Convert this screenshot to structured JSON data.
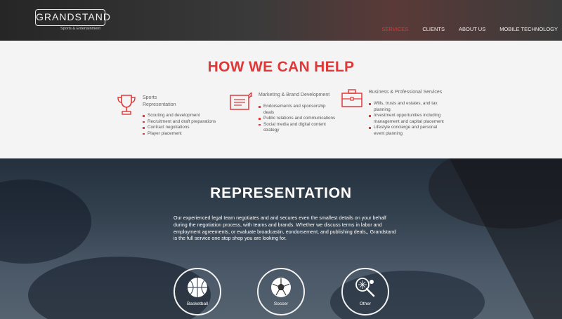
{
  "header": {
    "logo": "GRANDSTAND",
    "tagline": "Sports & Entertainment",
    "nav": [
      {
        "label": "SERVICES",
        "active": true
      },
      {
        "label": "CLIENTS",
        "active": false
      },
      {
        "label": "ABOUT US",
        "active": false
      },
      {
        "label": "MOBILE TECHNOLOGY",
        "active": false
      }
    ]
  },
  "help": {
    "title": "HOW WE CAN HELP",
    "services": [
      {
        "title_line1": "Sports",
        "title_line2": "Representation",
        "icon": "trophy-icon",
        "items": [
          "Scouting and development",
          "Recruitment and draft preparations",
          "Contract negotiations",
          "Player placement"
        ]
      },
      {
        "title_line1": "Marketing & Brand Development",
        "title_line2": "",
        "icon": "billboard-icon",
        "items": [
          "Endorsements and sponsorship deals",
          "Public relations and communications",
          "Social media and digital content strategy"
        ]
      },
      {
        "title_line1": "Business & Professional Services",
        "title_line2": "",
        "icon": "briefcase-icon",
        "items": [
          "Wills, trusts and estates, and tax planning",
          "Investment opportunities including management and capital placement",
          "Lifestyle concierge and personal event planning"
        ]
      }
    ]
  },
  "representation": {
    "title": "REPRESENTATION",
    "text": "Our experienced legal team negotiates and and secures even the smallest details on your behalf during the negotiation process, with teams and brands. Whether we discuss terms in labor and employment agreements, or evaluate broadcastin, eondorsement, and publishing deals,, Grandstand is the full service one stop shop you are looking for.",
    "sports": [
      {
        "label": "Basketball",
        "icon": "basketball-icon"
      },
      {
        "label": "Soccer",
        "icon": "soccer-ball-icon"
      },
      {
        "label": "Other",
        "icon": "tennis-icon"
      }
    ]
  },
  "colors": {
    "accent": "#e03838",
    "header_bg": "#2e2e2e",
    "section_bg": "#f4f4f4"
  }
}
